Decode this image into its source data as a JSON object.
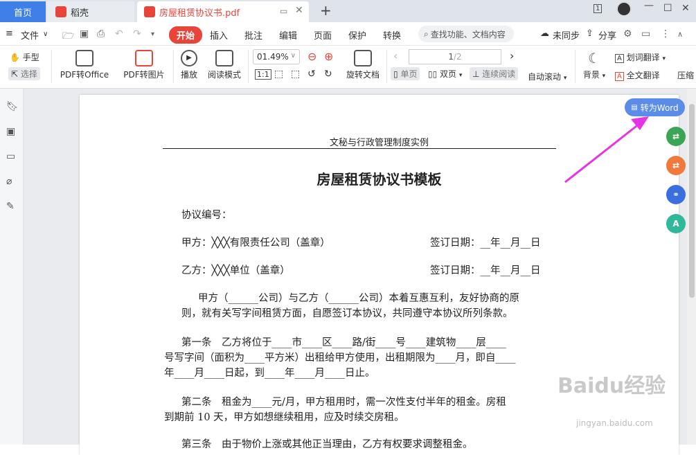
{
  "tabs": {
    "home": "首页",
    "docer": "稻壳",
    "pdf": "房屋租赁协议书.pdf",
    "one": "1"
  },
  "menu": {
    "file": "文件",
    "start": "开始",
    "insert": "插入",
    "annotate": "批注",
    "edit": "编辑",
    "page": "页面",
    "protect": "保护",
    "convert": "转换",
    "search": "查找功能、文档内容",
    "sync": "未同步",
    "share": "分享"
  },
  "toolbar": {
    "hand": "手型",
    "select": "选择",
    "pdf_office": "PDF转Office",
    "pdf_image": "PDF转图片",
    "play": "播放",
    "read_mode": "阅读模式",
    "zoom": "01.49%",
    "rotate": "旋转文档",
    "page_current": "1",
    "page_total": "/2",
    "single": "单页",
    "double": "双页",
    "continuous": "连续阅读",
    "auto_scroll": "自动滚动",
    "background": "背景",
    "word_translate": "划词翻译",
    "full_translate": "全文翻译",
    "compress": "压缩"
  },
  "float": {
    "to_word": "转为Word"
  },
  "document": {
    "header": "文秘与行政管理制度实例",
    "title": "房屋租赁协议书模板",
    "lines": [
      "协议编号：",
      "甲方：╳╳╳有限责任公司（盖章）",
      "签订日期：__年__月__日",
      "乙方：╳╳╳单位（盖章）",
      "签订日期：__年__月__日",
      "甲方（______公司）与乙方（______公司）本着互惠互利，友好协商的原",
      "则，就有关写字间租赁方面，自愿签订本协议，共同遵守本协议所列条款。",
      "第一条　乙方将位于____市____区____路/街____号____建筑物____层____",
      "号写字间（面积为____平方米）出租给甲方使用，出租期限为____月，即自____",
      "年____月____日起，到____年____月____日止。",
      "第二条　租金为____元/月，甲方租用时，需一次性支付半年的租金。房租",
      "到期前 10 天，甲方如想继续租用，应及时续交房租。",
      "第三条　由于物价上涨或其他正当理由，乙方有权要求调整租金。"
    ]
  },
  "watermark": {
    "brand": "Baidu经验",
    "url": "jingyan.baidu.com"
  },
  "colors": {
    "accent": "#3f7fe8",
    "start": "#e8443a",
    "arrow": "#e633e6"
  }
}
